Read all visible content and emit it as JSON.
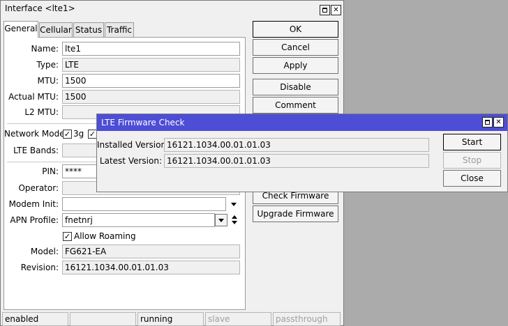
{
  "main_window": {
    "title": "Interface <lte1>",
    "tabs": [
      "General",
      "Cellular",
      "Status",
      "Traffic"
    ],
    "fields": {
      "name": {
        "label": "Name:",
        "value": "lte1"
      },
      "type": {
        "label": "Type:",
        "value": "LTE"
      },
      "mtu": {
        "label": "MTU:",
        "value": "1500"
      },
      "actual_mtu": {
        "label": "Actual MTU:",
        "value": "1500"
      },
      "l2_mtu": {
        "label": "L2 MTU:",
        "value": ""
      },
      "network_mode": {
        "label": "Network Mode:",
        "options": [
          "3g"
        ]
      },
      "lte_bands": {
        "label": "LTE Bands:",
        "value": ""
      },
      "pin": {
        "label": "PIN:",
        "value": "****"
      },
      "operator": {
        "label": "Operator:",
        "value": ""
      },
      "modem_init": {
        "label": "Modem Init:",
        "value": ""
      },
      "apn_profile": {
        "label": "APN Profile:",
        "value": "fnetnrj"
      },
      "allow_roaming": {
        "label": "Allow Roaming",
        "checked": true
      },
      "model": {
        "label": "Model:",
        "value": "FG621-EA"
      },
      "revision": {
        "label": "Revision:",
        "value": "16121.1034.00.01.01.03"
      }
    },
    "buttons": [
      "OK",
      "Cancel",
      "Apply",
      "Disable",
      "Comment",
      "Check Firmware",
      "Upgrade Firmware"
    ],
    "status_bar": [
      "enabled",
      "",
      "running",
      "slave",
      "passthrough"
    ]
  },
  "dialog": {
    "title": "LTE Firmware Check",
    "installed_label": "Installed Version:",
    "installed_value": "16121.1034.00.01.01.03",
    "latest_label": "Latest Version:",
    "latest_value": "16121.1034.00.01.01.03",
    "buttons": {
      "start": "Start",
      "stop": "Stop",
      "close": "Close"
    }
  },
  "icons": [
    "restore-icon",
    "close-icon",
    "checkbox-check-icon",
    "dropdown-arrow-icon",
    "up-down-arrow-icon"
  ]
}
